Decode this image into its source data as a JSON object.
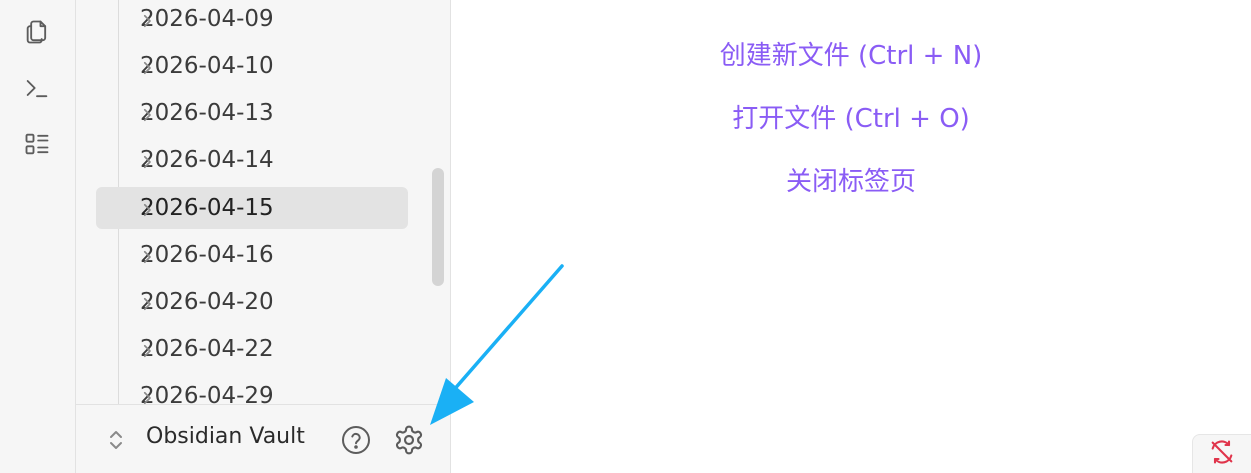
{
  "ribbon": {
    "items": [
      {
        "icon": "files-icon"
      },
      {
        "icon": "terminal-icon"
      },
      {
        "icon": "list-icon"
      }
    ]
  },
  "sidebar": {
    "items": [
      {
        "label": "2026-04-09",
        "active": false
      },
      {
        "label": "2026-04-10",
        "active": false
      },
      {
        "label": "2026-04-13",
        "active": false
      },
      {
        "label": "2026-04-14",
        "active": false
      },
      {
        "label": "2026-04-15",
        "active": true
      },
      {
        "label": "2026-04-16",
        "active": false
      },
      {
        "label": "2026-04-20",
        "active": false
      },
      {
        "label": "2026-04-22",
        "active": false
      },
      {
        "label": "2026-04-29",
        "active": false
      }
    ]
  },
  "footer": {
    "vault_name": "Obsidian Vault",
    "help_icon": "help-icon",
    "settings_icon": "gear-icon"
  },
  "empty_state": {
    "create_new": "创建新文件 (Ctrl + N)",
    "open_file": "打开文件 (Ctrl + O)",
    "close_tab": "关闭标签页"
  },
  "colors": {
    "accent": "#8a5cf5",
    "annotation_arrow": "#1ab0f5",
    "sync_error": "#e0344b"
  }
}
